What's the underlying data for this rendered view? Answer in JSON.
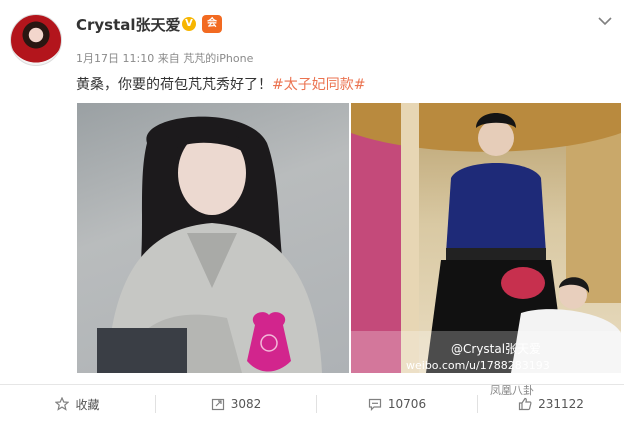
{
  "post": {
    "username": "Crystal张天爱",
    "verified_badge": "V",
    "member_badge": "会",
    "date": "1月17日 11:10",
    "source_prefix": "来自",
    "source": "芃芃的iPhone",
    "text": "黄桑，你要的荷包芃芃秀好了！",
    "hashtag": "#太子妃同款#"
  },
  "images": {
    "left_caption": "",
    "right_watermark_name": "@Crystal张天爱",
    "right_watermark_url": "weibo.com/u/1788283193"
  },
  "toolbar": {
    "favorite_label": "收藏",
    "repost_count": "3082",
    "comment_count": "10706",
    "like_count": "231122"
  },
  "watermark": {
    "text": "凤凰八卦"
  },
  "colors": {
    "hashtag": "#eb7350",
    "verified": "#f7b500",
    "member": "#f26a21"
  },
  "icons": {
    "favorite": "star-icon",
    "repost": "repost-icon",
    "comment": "comment-icon",
    "like": "thumbs-up-icon",
    "menu": "chevron-down-icon"
  }
}
